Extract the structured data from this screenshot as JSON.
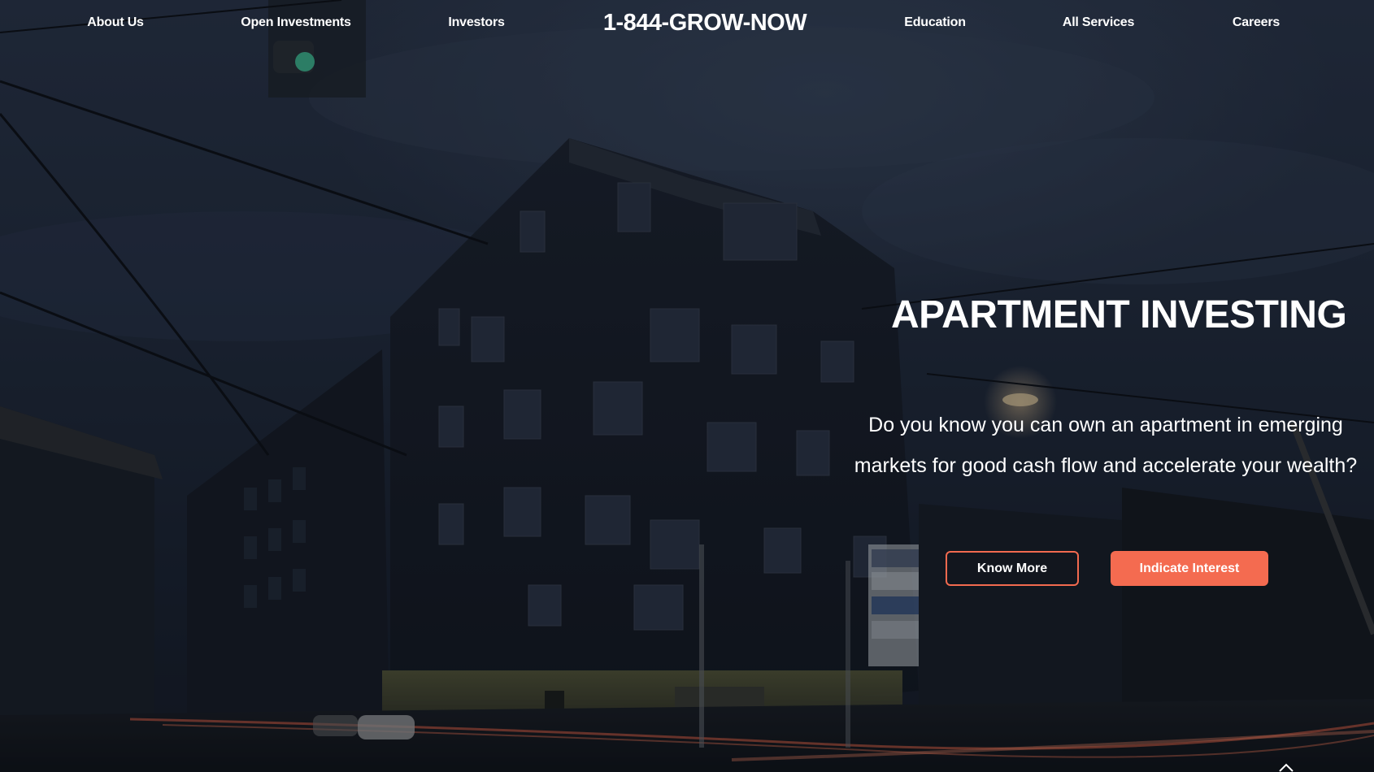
{
  "nav": {
    "items_left": [
      {
        "label": "About Us"
      },
      {
        "label": "Open Investments"
      },
      {
        "label": "Investors"
      }
    ],
    "phone": "1-844-GROW-NOW",
    "items_right": [
      {
        "label": "Education"
      },
      {
        "label": "All Services"
      },
      {
        "label": "Careers"
      }
    ]
  },
  "hero": {
    "title": "APARTMENT INVESTING",
    "subtitle_line1": "Do you know you can own an apartment in emerging",
    "subtitle_line2": "markets for good cash flow and accelerate your wealth?",
    "know_more_label": "Know More",
    "indicate_interest_label": "Indicate Interest"
  },
  "colors": {
    "accent": "#f46b50",
    "text": "#ffffff",
    "background": "#1b2230"
  },
  "icons": {
    "scroll_up": "chevron-up-icon"
  }
}
